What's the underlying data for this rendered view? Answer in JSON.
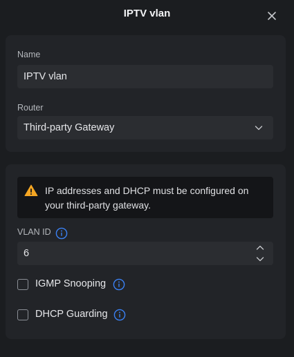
{
  "dialog": {
    "title": "IPTV vlan"
  },
  "icons": {
    "close": "close-icon",
    "chevron": "chevron-down-icon",
    "warning": "warning-icon",
    "info": "info-icon"
  },
  "colors": {
    "background": "#1b1d20",
    "card": "#222428",
    "input": "#2b2d31",
    "warning": "#f5a623",
    "info": "#3b82f6"
  },
  "form": {
    "name_label": "Name",
    "name_value": "IPTV vlan",
    "router_label": "Router",
    "router_value": "Third-party Gateway",
    "warning_text": "IP addresses and DHCP must be configured on your third-party gateway.",
    "vlan_id_label": "VLAN ID",
    "vlan_id_value": "6",
    "igmp_label": "IGMP Snooping",
    "igmp_checked": false,
    "dhcp_label": "DHCP Guarding",
    "dhcp_checked": false
  }
}
